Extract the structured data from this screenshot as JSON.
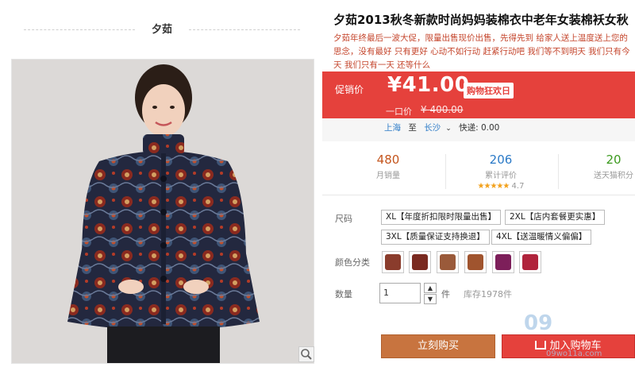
{
  "shop": {
    "name": "夕茹"
  },
  "product": {
    "title": "夕茹2013秋冬新款时尚妈妈装棉衣中老年女装棉袄女秋",
    "subtitle": "夕茹年终最后一波大促，限量出售现价出售，先得先到 给家人送上温度送上您的思念，没有最好 只有更好 心动不如行动 赶紧行动吧 我们等不到明天 我们只有今天 我们只有一天 还等什么"
  },
  "promo": {
    "label": "促销价",
    "price": "¥41.00",
    "badge": "购物狂欢日",
    "orig_label": "一口价",
    "orig_price": "¥ 400.00",
    "colors": {
      "bg": "#e5413c"
    }
  },
  "shipping": {
    "from": "上海",
    "to_word": "至",
    "dest": "长沙",
    "express": "快递: 0.00"
  },
  "stats": [
    {
      "value": "480",
      "label": "月销量"
    },
    {
      "value": "206",
      "label": "累计评价",
      "rating": "★★★★★",
      "score": "4.7"
    },
    {
      "value": "20",
      "label": "送天猫积分"
    }
  ],
  "options": {
    "size_label": "尺码",
    "sizes": [
      "XL【年度折扣限时限量出售】",
      "2XL【店内套餐更实惠】",
      "3XL【质量保证支持换退】",
      "4XL【送温暖情义偏偏】"
    ],
    "color_label": "颜色分类",
    "swatches": [
      "#8a3c2c",
      "#7a2a20",
      "#9a5a3a",
      "#a0542e",
      "#7d1f5a",
      "#b0243c"
    ],
    "qty_label": "数量",
    "qty_value": "1",
    "stepper_up": "▲",
    "stepper_down": "▼",
    "qty_unit": "件",
    "stock": "库存1978件"
  },
  "actions": {
    "buy_now": "立刻购买",
    "add_cart": "加入购物车"
  },
  "watermark": {
    "main": "09",
    "sub": "09wo11a.com"
  }
}
